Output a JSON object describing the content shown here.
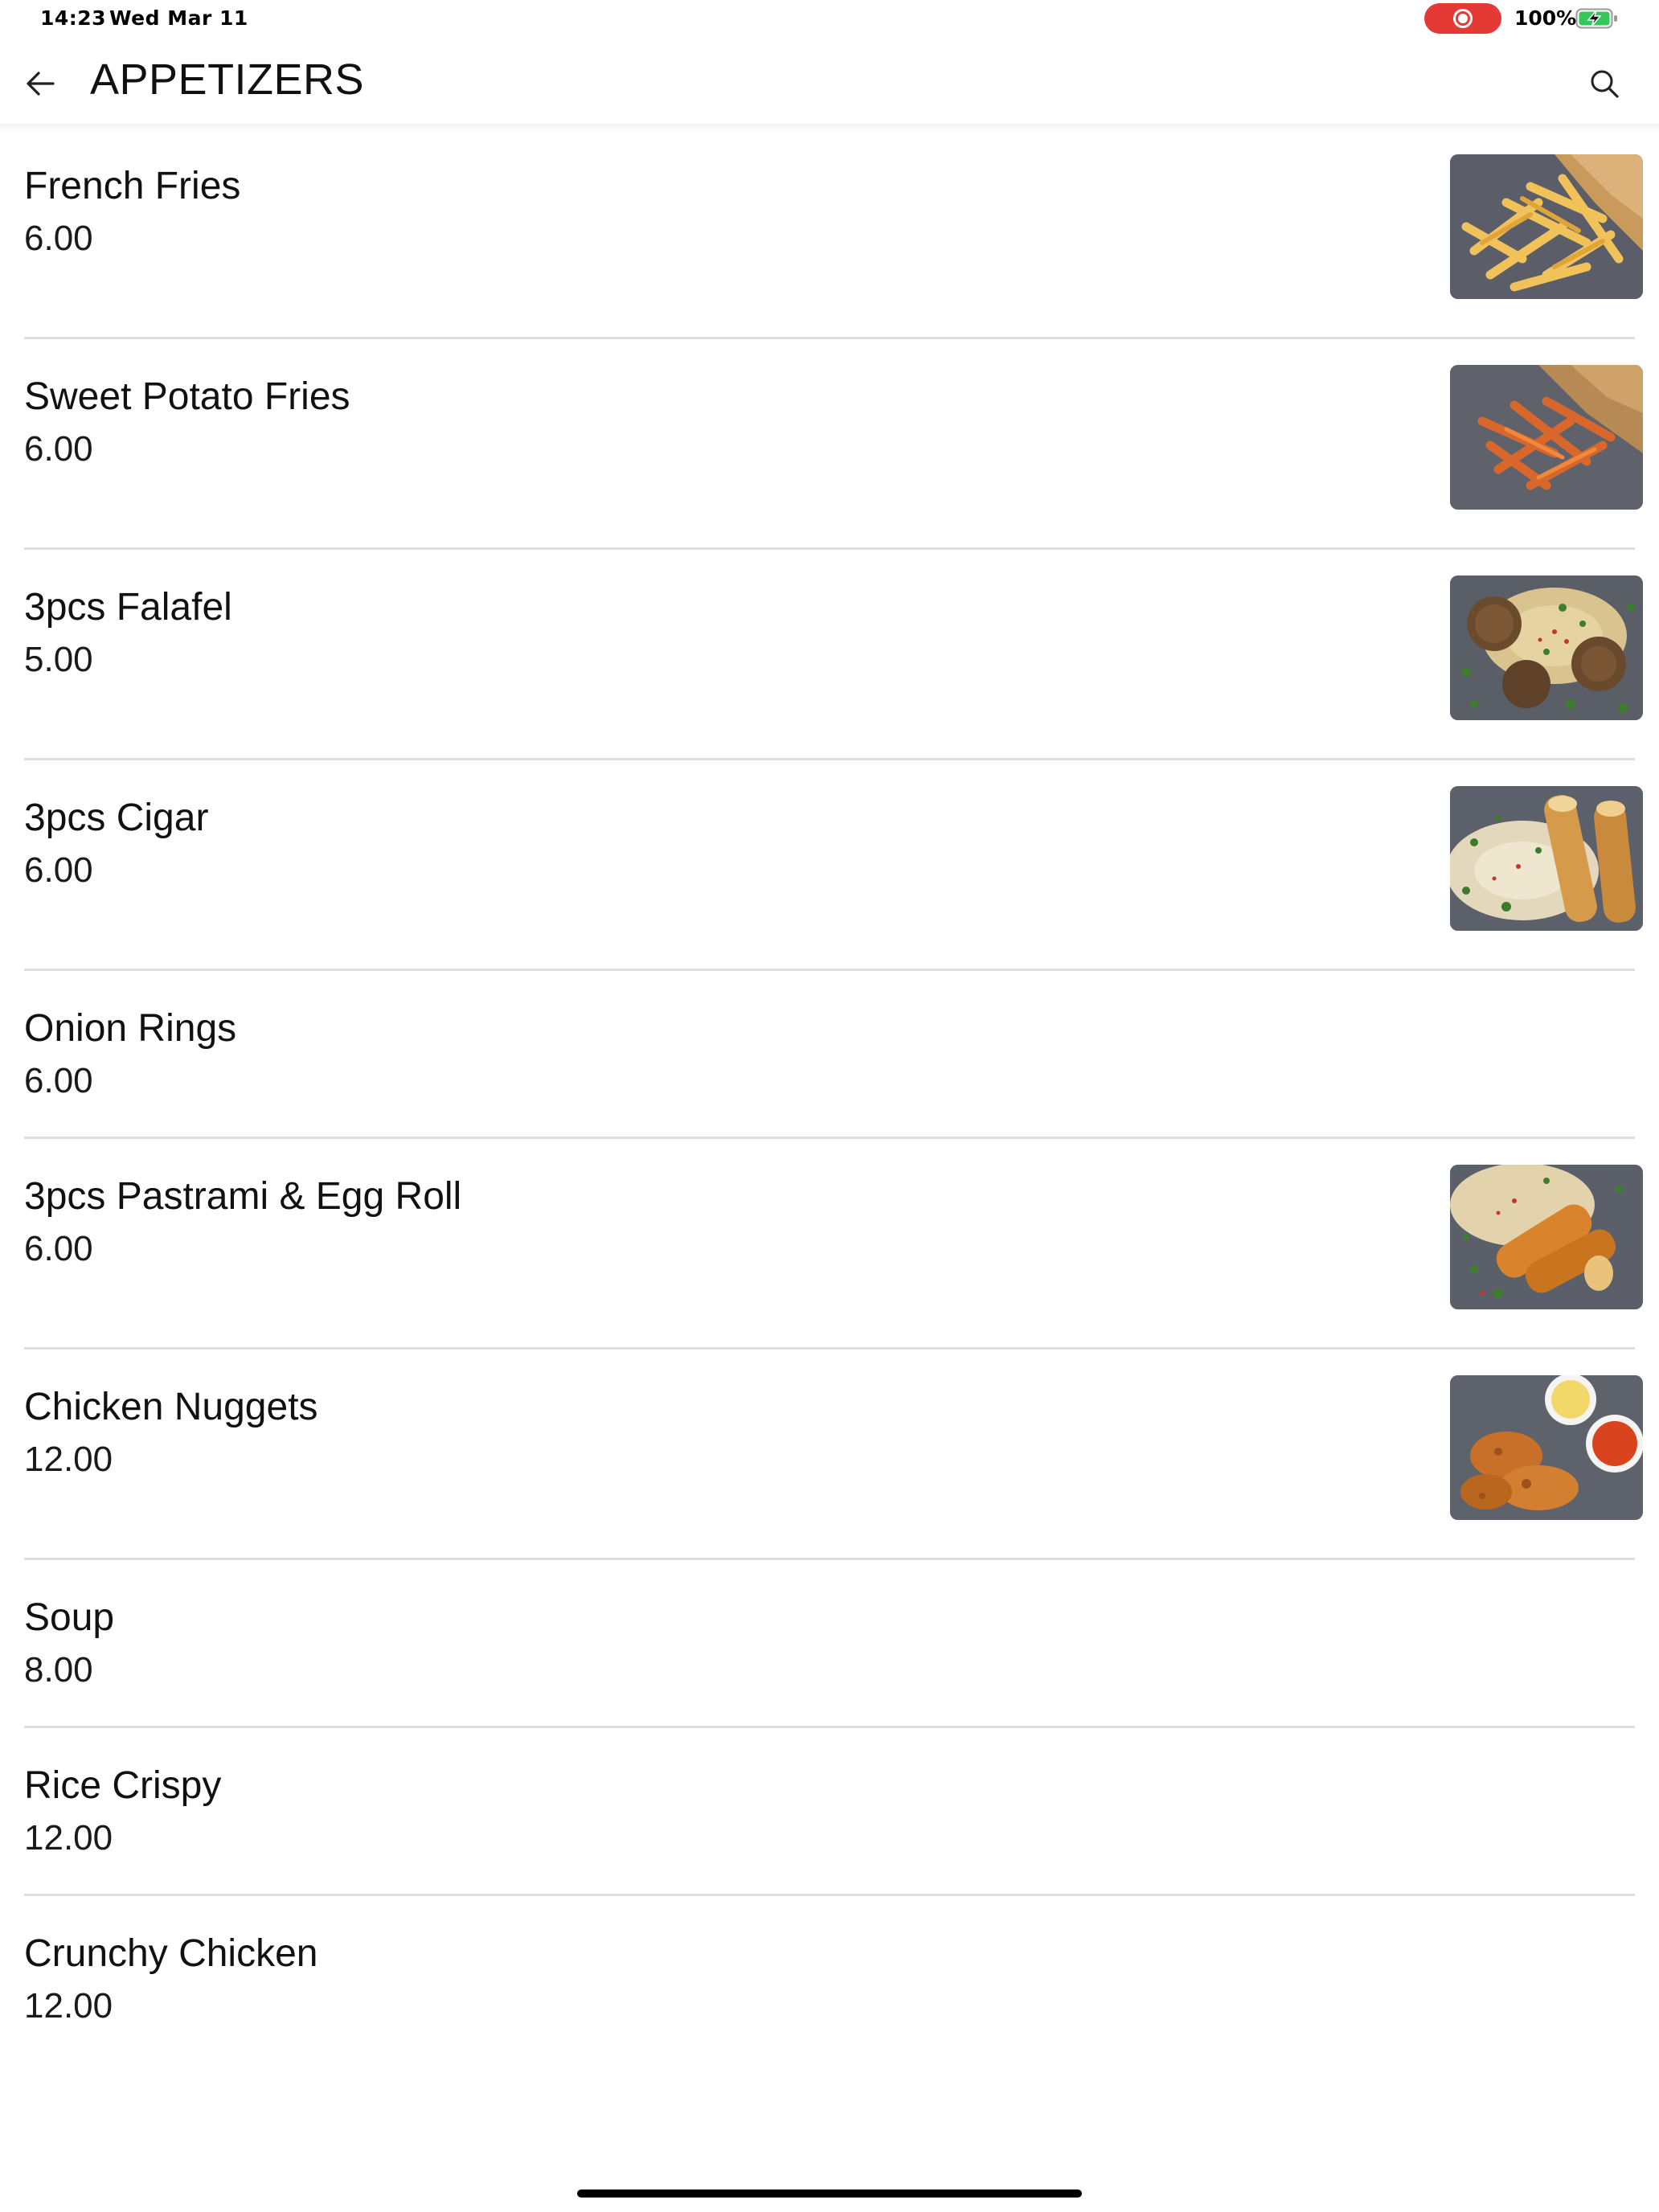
{
  "status_bar": {
    "time": "14:23",
    "date": "Wed Mar 11",
    "battery": "100%",
    "recording_indicator": "record-icon",
    "accent_color": "#e53935"
  },
  "header": {
    "title": "APPETIZERS",
    "back_icon": "arrow-left-icon",
    "search_icon": "search-icon"
  },
  "items": [
    {
      "name": "French Fries",
      "price": "6.00",
      "photo": "french-fries-photo"
    },
    {
      "name": "Sweet Potato Fries",
      "price": "6.00",
      "photo": "sweet-potato-fries-photo"
    },
    {
      "name": "3pcs Falafel",
      "price": "5.00",
      "photo": "falafel-photo"
    },
    {
      "name": "3pcs Cigar",
      "price": "6.00",
      "photo": "cigar-photo"
    },
    {
      "name": "Onion Rings",
      "price": "6.00",
      "photo": null
    },
    {
      "name": "3pcs Pastrami & Egg Roll",
      "price": "6.00",
      "photo": "pastrami-egg-roll-photo"
    },
    {
      "name": "Chicken Nuggets",
      "price": "12.00",
      "photo": "chicken-nuggets-photo"
    },
    {
      "name": "Soup",
      "price": "8.00",
      "photo": null
    },
    {
      "name": "Rice Crispy",
      "price": "12.00",
      "photo": null
    },
    {
      "name": "Crunchy Chicken",
      "price": "12.00",
      "photo": null
    }
  ]
}
